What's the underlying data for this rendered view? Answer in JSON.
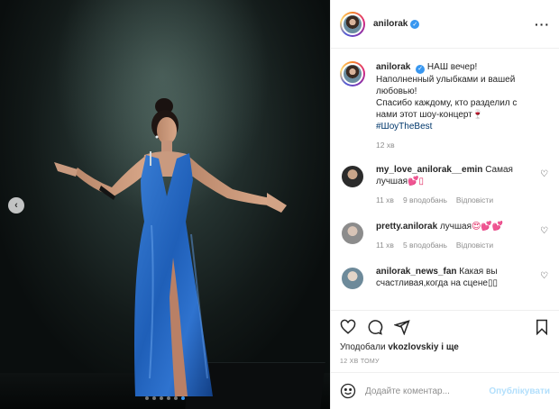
{
  "post": {
    "username": "anilorak",
    "more_icon": "more-horizontal-icon",
    "slide_count": 6,
    "active_slide": 5
  },
  "caption": {
    "username": "anilorak",
    "lines": [
      "НАШ вечер!",
      "Наполненный улыбками и вашей любовью!",
      "Спасибо каждому, кто разделил с нами этот шоу-концерт🍷"
    ],
    "hashtag": "#ШоуTheBest",
    "time": "12 хв"
  },
  "comments": [
    {
      "username": "my_love_anilorak__emin",
      "text": "Самая лучшая",
      "emoji": "💕▯",
      "time": "11 хв",
      "likes": "9 вподобань",
      "reply": "Відповісти",
      "avatar_colors": [
        "#2b2b2b",
        "#c9a58a"
      ]
    },
    {
      "username": "pretty.anilorak",
      "text": "лучшая",
      "emoji": "😍💕💕",
      "time": "11 хв",
      "likes": "5 вподобань",
      "reply": "Відповісти",
      "avatar_colors": [
        "#8c8c8c",
        "#d8c4b6"
      ]
    },
    {
      "username": "anilorak_news_fan",
      "text": "Какая вы счастливая,когда на сцене▯▯",
      "emoji": "",
      "time": "",
      "likes": "",
      "reply": "",
      "avatar_colors": [
        "#6d8a9a",
        "#e3d5c8"
      ]
    }
  ],
  "actions": {
    "like_icon": "heart-icon",
    "comment_icon": "comment-icon",
    "share_icon": "share-icon",
    "save_icon": "bookmark-icon"
  },
  "likes": {
    "prefix": "Уподобали",
    "user": "vkozlovskiy",
    "suffix": "і ще"
  },
  "timestamp": "12 ХВ ТОМУ",
  "add_comment": {
    "placeholder": "Додайте коментар...",
    "publish_label": "Опублікувати",
    "emoji_icon": "smiley-icon"
  },
  "colors": {
    "dress": "#1f5fb8",
    "link": "#00376b",
    "verified": "#3897f0",
    "publish_disabled": "#b2dffc"
  }
}
